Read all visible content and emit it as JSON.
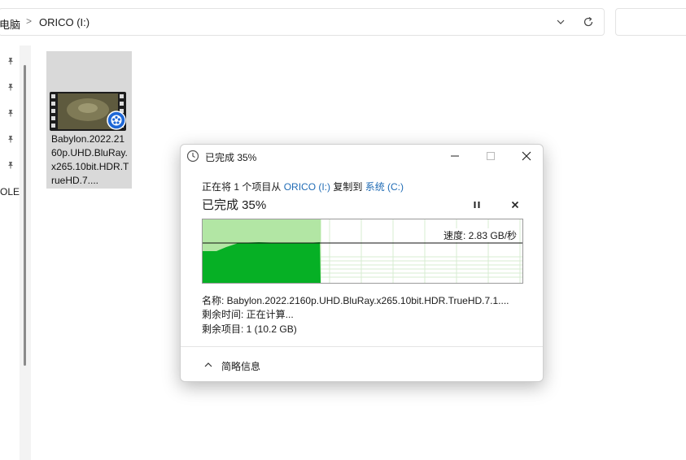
{
  "explorer": {
    "breadcrumb": {
      "pc": "电脑",
      "separator": ">",
      "drive": "ORICO (I:)"
    },
    "nav": {
      "partial_label": "OLE"
    },
    "file": {
      "name": "Babylon.2022.2160p.UHD.BluRay.x265.10bit.HDR.TrueHD.7...."
    }
  },
  "dialog": {
    "title": "已完成 35%",
    "summary": {
      "prefix": "正在将 1 个项目从 ",
      "source": "ORICO (I:)",
      "middle": " 复制到 ",
      "destination": "系统 (C:)"
    },
    "progress_title": "已完成 35%",
    "progress_percent": 35,
    "speed": "速度: 2.83 GB/秒",
    "name_line": "名称:  Babylon.2022.2160p.UHD.BluRay.x265.10bit.HDR.TrueHD.7.1....",
    "time_line": "剩余时间:  正在计算...",
    "items_line": "剩余项目:  1 (10.2 GB)",
    "less_details": "简略信息"
  },
  "colors": {
    "progress_fill": "#06b025",
    "progress_bg": "#b2e6a4",
    "link": "#1f6bb5"
  }
}
